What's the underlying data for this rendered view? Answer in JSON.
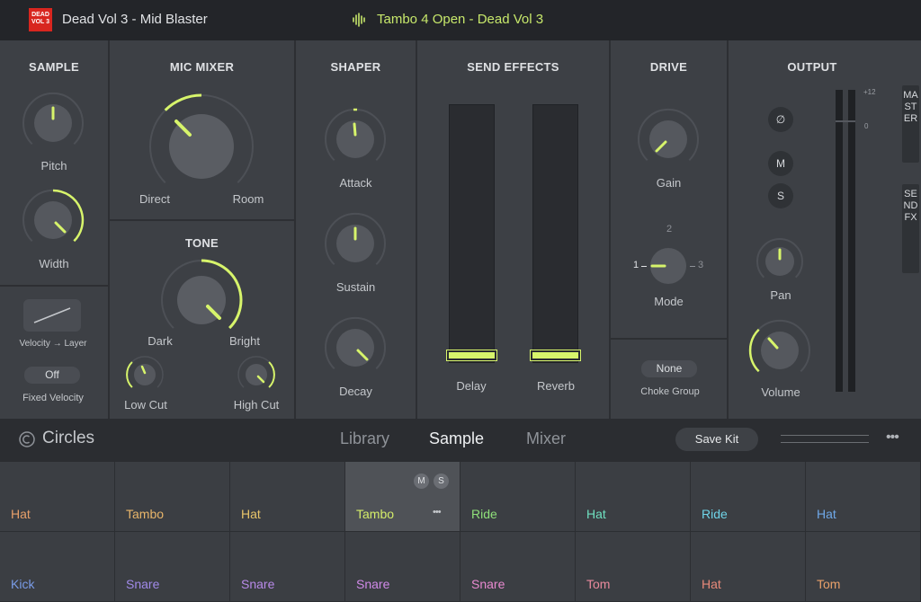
{
  "header": {
    "logo_text": "DEAD VOL 3",
    "kit_title": "Dead Vol 3 - Mid Blaster",
    "now_playing": "Tambo 4 Open - Dead Vol 3",
    "accent_color": "#c7e86b"
  },
  "sections": {
    "sample": {
      "title": "SAMPLE",
      "pitch_label": "Pitch",
      "width_label": "Width",
      "velocity_layer_label": "Velocity → Layer",
      "fixed_velocity_value": "Off",
      "fixed_velocity_label": "Fixed Velocity"
    },
    "mic_mixer": {
      "title": "MIC MIXER",
      "left_label": "Direct",
      "right_label": "Room"
    },
    "tone": {
      "title": "TONE",
      "left_label": "Dark",
      "right_label": "Bright",
      "low_cut_label": "Low Cut",
      "high_cut_label": "High Cut"
    },
    "shaper": {
      "title": "SHAPER",
      "attack_label": "Attack",
      "sustain_label": "Sustain",
      "decay_label": "Decay"
    },
    "send_effects": {
      "title": "SEND EFFECTS",
      "delay_label": "Delay",
      "reverb_label": "Reverb"
    },
    "drive": {
      "title": "DRIVE",
      "gain_label": "Gain",
      "mode_label": "Mode",
      "mode_1": "1",
      "mode_2": "2",
      "mode_3": "3",
      "choke_value": "None",
      "choke_label": "Choke Group"
    },
    "output": {
      "title": "OUTPUT",
      "phase_symbol": "∅",
      "mute_label": "M",
      "solo_label": "S",
      "pan_label": "Pan",
      "volume_label": "Volume",
      "meter_top": "+12",
      "meter_zero": "0",
      "master_tab": "MASTER",
      "send_fx_tab": "SEND FX"
    }
  },
  "nav": {
    "brand": "Circles",
    "tabs": [
      "Library",
      "Sample",
      "Mixer"
    ],
    "active_tab": "Sample",
    "save_kit": "Save Kit"
  },
  "pads": {
    "row1": [
      {
        "label": "Hat",
        "color": "#e8a06a"
      },
      {
        "label": "Tambo",
        "color": "#e8b56a"
      },
      {
        "label": "Hat",
        "color": "#e8c56a"
      },
      {
        "label": "Tambo",
        "color": "#d4ec6a"
      },
      {
        "label": "Ride",
        "color": "#8fe07a"
      },
      {
        "label": "Hat",
        "color": "#6fe0c0"
      },
      {
        "label": "Ride",
        "color": "#6fd4e8"
      },
      {
        "label": "Hat",
        "color": "#6fa8e8"
      }
    ],
    "row2": [
      {
        "label": "Kick",
        "color": "#7a9ce8"
      },
      {
        "label": "Snare",
        "color": "#a08ae8"
      },
      {
        "label": "Snare",
        "color": "#b88ae8"
      },
      {
        "label": "Snare",
        "color": "#d08ae8"
      },
      {
        "label": "Snare",
        "color": "#e88ad0"
      },
      {
        "label": "Tom",
        "color": "#e88a9c"
      },
      {
        "label": "Hat",
        "color": "#e88a7a"
      },
      {
        "label": "Tom",
        "color": "#e8a06a"
      }
    ],
    "selected_mute": "M",
    "selected_solo": "S"
  }
}
